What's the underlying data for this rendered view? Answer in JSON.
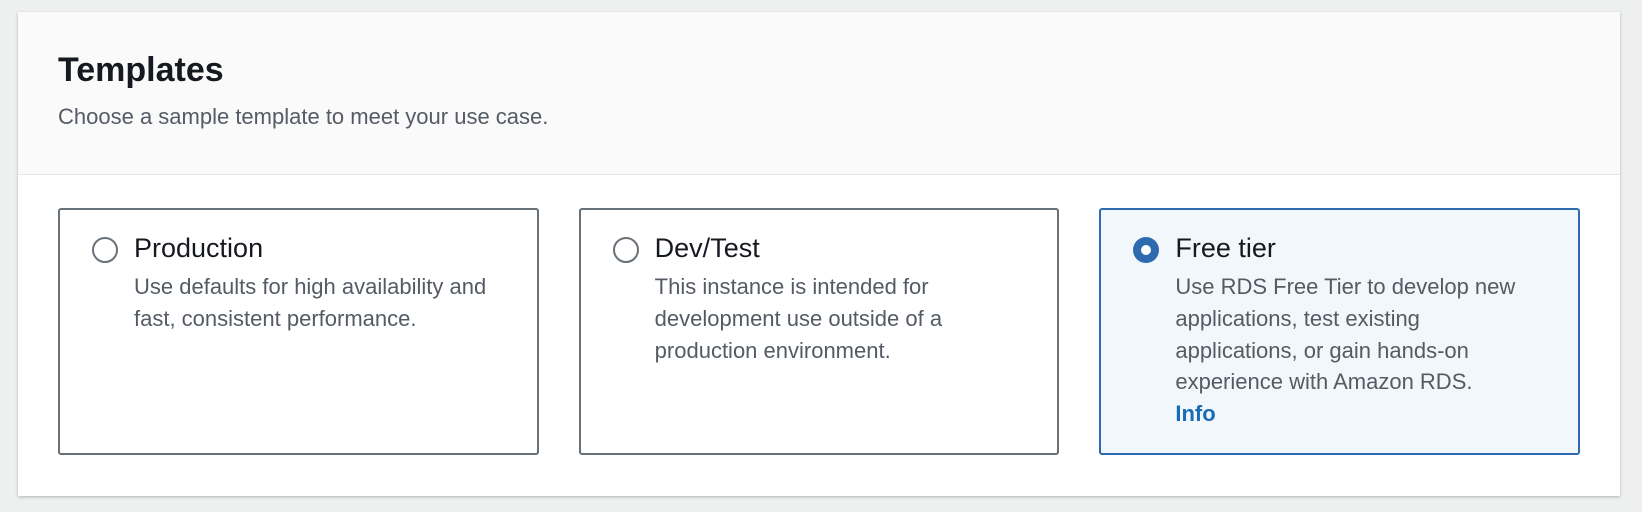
{
  "section": {
    "title": "Templates",
    "description": "Choose a sample template to meet your use case."
  },
  "templates": [
    {
      "label": "Production",
      "description": "Use defaults for high availability and fast, consistent performance.",
      "selected": false
    },
    {
      "label": "Dev/Test",
      "description": "This instance is intended for development use outside of a production environment.",
      "selected": false
    },
    {
      "label": "Free tier",
      "description": "Use RDS Free Tier to develop new applications, test existing applications, or gain hands-on experience with Amazon RDS.",
      "info_link": "Info",
      "selected": true
    }
  ],
  "colors": {
    "accent": "#2e6ab0",
    "selected_background": "#f1f7fb",
    "link": "#1a6bb8"
  },
  "icons": {
    "radio_unchecked": "radio-unchecked-icon",
    "radio_checked": "radio-checked-icon"
  }
}
